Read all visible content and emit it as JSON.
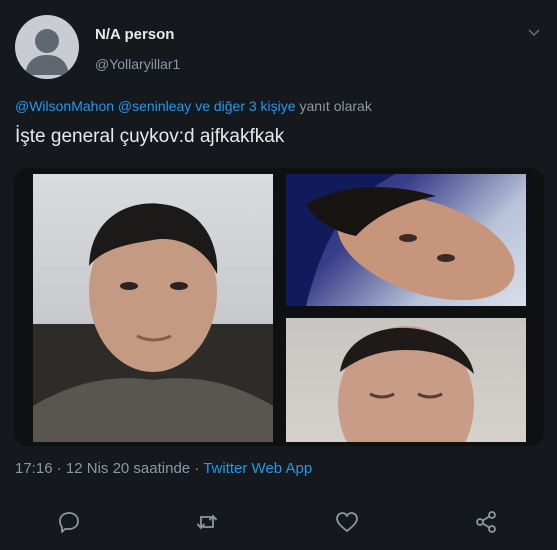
{
  "author": {
    "display_name": "N/A person",
    "handle": "@Yollaryillar1"
  },
  "reply_context": {
    "mention_1": "@WilsonMahon",
    "mention_2": "@seninleay",
    "others": "ve diğer 3 kişiye",
    "suffix": "yanıt olarak"
  },
  "tweet": {
    "text": "İşte general çuykov:d ajfkakfkak"
  },
  "meta": {
    "time": "17:16",
    "date": "12 Nis 20 saatinde",
    "separator": "·",
    "source": "Twitter Web App"
  },
  "icons": {
    "menu": "chevron-down-icon",
    "reply": "comment-icon",
    "retweet": "retweet-icon",
    "like": "heart-icon",
    "share": "share-icon"
  },
  "colors": {
    "background": "#15181c",
    "link": "#1d9bf0",
    "secondary_text": "#8b98a5",
    "primary_text": "#e7e9ea"
  }
}
